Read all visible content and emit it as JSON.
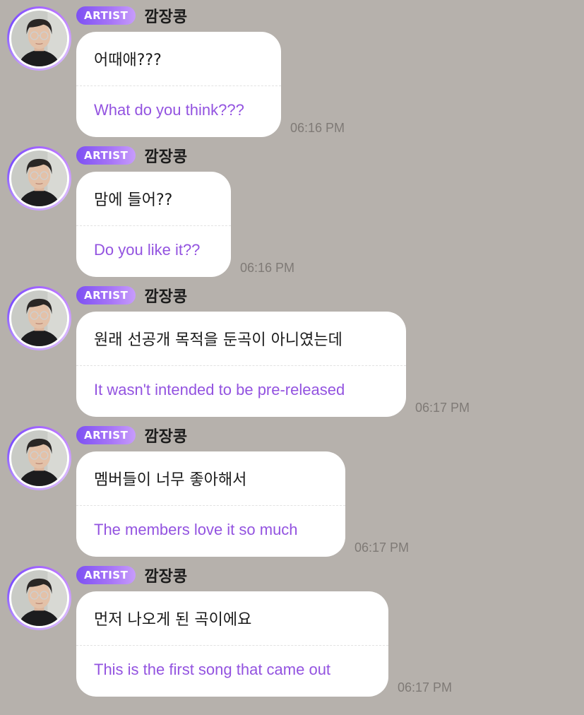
{
  "badge_label": "ARTIST",
  "author_name": "깜장콩",
  "colors": {
    "background": "#b6b1ac",
    "bubble": "#ffffff",
    "translation_text": "#9353e0",
    "badge_start": "#7d50f3",
    "badge_end": "#c79cfb",
    "timestamp": "#7f7a76"
  },
  "messages": [
    {
      "original": "어때애???",
      "translation": "What do you think???",
      "time": "06:16 PM"
    },
    {
      "original": "맘에 들어??",
      "translation": "Do you like it??",
      "time": "06:16 PM"
    },
    {
      "original": "원래 선공개 목적을 둔곡이 아니였는데",
      "translation": "It wasn't intended to be pre-released",
      "time": "06:17 PM"
    },
    {
      "original": "멤버들이 너무 좋아해서",
      "translation": "The members love it so much",
      "time": "06:17 PM"
    },
    {
      "original": "먼저 나오게 된 곡이에요",
      "translation": "This is the first song that came out",
      "time": "06:17 PM"
    }
  ]
}
